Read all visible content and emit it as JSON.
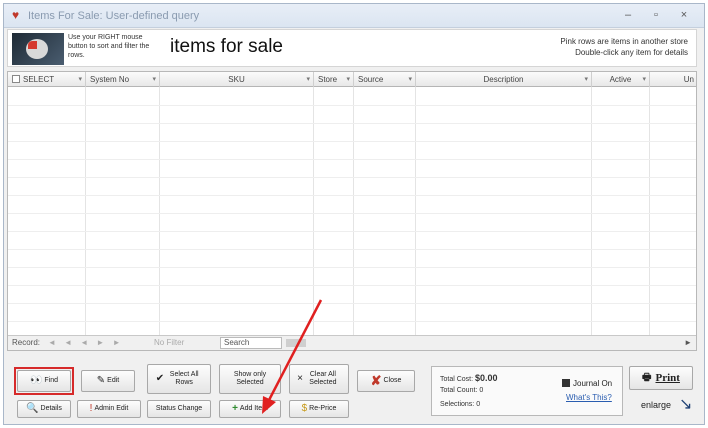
{
  "window": {
    "title": "Items For Sale: User-defined query",
    "minimize": "–",
    "maximize": "▫",
    "close": "×"
  },
  "header": {
    "hint": "Use your RIGHT mouse button to sort and filter the rows.",
    "title": "items for sale",
    "note_line1": "Pink rows are items in another store",
    "note_line2": "Double-click any item for details"
  },
  "grid": {
    "columns": [
      "SELECT",
      "System No",
      "SKU",
      "Store",
      "Source",
      "Description",
      "Active",
      "Un"
    ]
  },
  "navbar": {
    "record_label": "Record:",
    "arrows": "◄ ◄ ◄ ► ►",
    "filter_label": "No Filter",
    "search_label": "Search",
    "scroll_right": "►"
  },
  "toolbar": {
    "find": "Find",
    "edit": "Edit",
    "select_all_rows": "Select All Rows",
    "show_only_selected": "Show only Selected",
    "clear_all_selected": "Clear All Selected",
    "close": "Close",
    "details": "Details",
    "admin_edit": "Admin Edit",
    "status_change": "Status Change",
    "add_item": "Add Item",
    "re_price": "Re-Price",
    "print": "Print",
    "enlarge": "enlarge"
  },
  "stats": {
    "total_cost_label": "Total Cost:",
    "total_cost_value": "$0.00",
    "total_count_label": "Total Count:",
    "total_count_value": "0",
    "selections_label": "Selections:",
    "selections_value": "0",
    "journal_label": "Journal On",
    "whats_this": "What's This?"
  },
  "colors": {
    "highlight_red": "#d62a2a",
    "annotation_arrow": "#e02020",
    "link_blue": "#2a5db0"
  }
}
